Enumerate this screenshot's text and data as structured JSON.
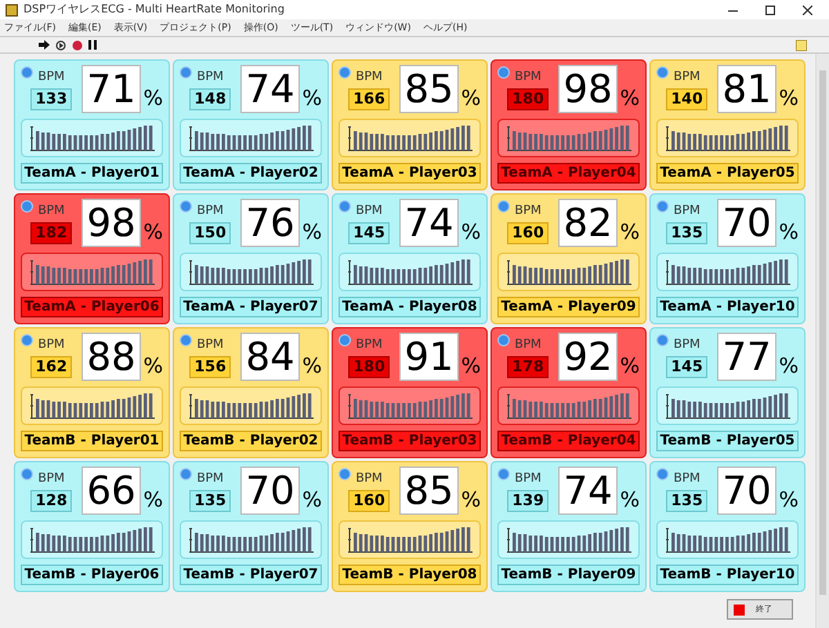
{
  "window": {
    "title": "DSPワイヤレスECG - Multi HeartRate Monitoring"
  },
  "menu": [
    "ファイル(F)",
    "編集(E)",
    "表示(V)",
    "プロジェクト(P)",
    "操作(O)",
    "ツール(T)",
    "ウィンドウ(W)",
    "ヘルプ(H)"
  ],
  "players": [
    {
      "name": "TeamA - Player01",
      "bpm_label": "BPM",
      "bpm": "133",
      "percent": "71",
      "unit": "%",
      "kind": "normal"
    },
    {
      "name": "TeamA - Player02",
      "bpm_label": "BPM",
      "bpm": "148",
      "percent": "74",
      "unit": "%",
      "kind": "normal"
    },
    {
      "name": "TeamA - Player03",
      "bpm_label": "BPM",
      "bpm": "166",
      "percent": "85",
      "unit": "%",
      "kind": "warning"
    },
    {
      "name": "TeamA - Player04",
      "bpm_label": "BPM",
      "bpm": "180",
      "percent": "98",
      "unit": "%",
      "kind": "alert"
    },
    {
      "name": "TeamA - Player05",
      "bpm_label": "BPM",
      "bpm": "140",
      "percent": "81",
      "unit": "%",
      "kind": "warning"
    },
    {
      "name": "TeamA - Player06",
      "bpm_label": "BPM",
      "bpm": "182",
      "percent": "98",
      "unit": "%",
      "kind": "alert"
    },
    {
      "name": "TeamA - Player07",
      "bpm_label": "BPM",
      "bpm": "150",
      "percent": "76",
      "unit": "%",
      "kind": "normal"
    },
    {
      "name": "TeamA - Player08",
      "bpm_label": "BPM",
      "bpm": "145",
      "percent": "74",
      "unit": "%",
      "kind": "normal"
    },
    {
      "name": "TeamA - Player09",
      "bpm_label": "BPM",
      "bpm": "160",
      "percent": "82",
      "unit": "%",
      "kind": "warning"
    },
    {
      "name": "TeamA - Player10",
      "bpm_label": "BPM",
      "bpm": "135",
      "percent": "70",
      "unit": "%",
      "kind": "normal"
    },
    {
      "name": "TeamB - Player01",
      "bpm_label": "BPM",
      "bpm": "162",
      "percent": "88",
      "unit": "%",
      "kind": "warning"
    },
    {
      "name": "TeamB - Player02",
      "bpm_label": "BPM",
      "bpm": "156",
      "percent": "84",
      "unit": "%",
      "kind": "warning"
    },
    {
      "name": "TeamB - Player03",
      "bpm_label": "BPM",
      "bpm": "180",
      "percent": "91",
      "unit": "%",
      "kind": "alert"
    },
    {
      "name": "TeamB - Player04",
      "bpm_label": "BPM",
      "bpm": "178",
      "percent": "92",
      "unit": "%",
      "kind": "alert"
    },
    {
      "name": "TeamB - Player05",
      "bpm_label": "BPM",
      "bpm": "145",
      "percent": "77",
      "unit": "%",
      "kind": "normal"
    },
    {
      "name": "TeamB - Player06",
      "bpm_label": "BPM",
      "bpm": "128",
      "percent": "66",
      "unit": "%",
      "kind": "normal"
    },
    {
      "name": "TeamB - Player07",
      "bpm_label": "BPM",
      "bpm": "135",
      "percent": "70",
      "unit": "%",
      "kind": "normal"
    },
    {
      "name": "TeamB - Player08",
      "bpm_label": "BPM",
      "bpm": "160",
      "percent": "85",
      "unit": "%",
      "kind": "warning"
    },
    {
      "name": "TeamB - Player09",
      "bpm_label": "BPM",
      "bpm": "139",
      "percent": "74",
      "unit": "%",
      "kind": "normal"
    },
    {
      "name": "TeamB - Player10",
      "bpm_label": "BPM",
      "bpm": "135",
      "percent": "70",
      "unit": "%",
      "kind": "normal"
    }
  ],
  "stop_button": {
    "label": "終了"
  }
}
